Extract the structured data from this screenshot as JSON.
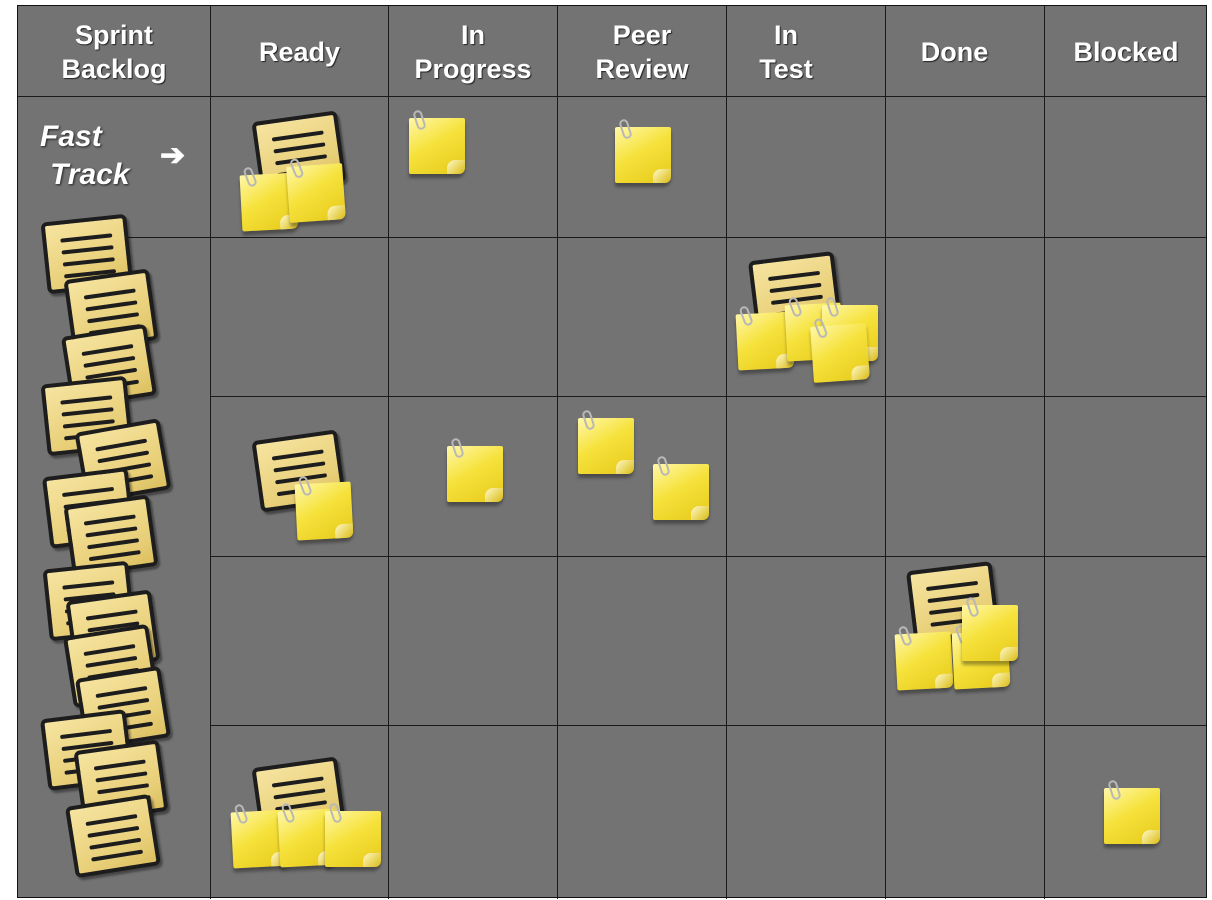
{
  "board": {
    "columns": [
      {
        "label": "Sprint\nBacklog"
      },
      {
        "label": "Ready"
      },
      {
        "label": "In\nProgress"
      },
      {
        "label": "Peer\nReview"
      },
      {
        "label": "In\nTest"
      },
      {
        "label": "Done"
      },
      {
        "label": "Blocked"
      }
    ],
    "fast_track": {
      "line1": "Fast",
      "line2": "Track",
      "arrow": "➔"
    },
    "colors": {
      "background": "#737373",
      "grid": "#1a1a1a",
      "header_text": "#ffffff",
      "story_card": "#f2dd8c",
      "task_note": "#f5e03a"
    }
  }
}
